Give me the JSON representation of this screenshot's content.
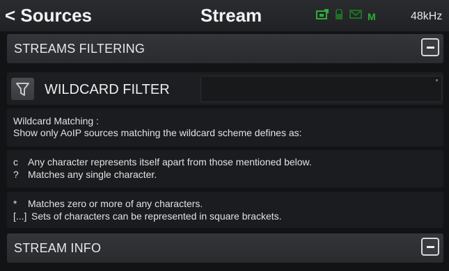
{
  "header": {
    "back_label": "< Sources",
    "title": "Stream",
    "sample_rate": "48kHz",
    "status_icons": [
      "network-icon",
      "lock-icon",
      "monitor-icon"
    ],
    "monitor_letter": "M"
  },
  "sections": {
    "streams_filtering": "STREAMS FILTERING",
    "stream_info": "STREAM INFO"
  },
  "filter": {
    "label": "WILDCARD FILTER",
    "value": ""
  },
  "info_blocks": {
    "matching": {
      "line1": "Wildcard Matching :",
      "line2": "Show only AoIP sources matching the wildcard scheme defines as:"
    },
    "rules1": [
      {
        "symbol": "c",
        "text": "Any character represents itself apart from those mentioned below."
      },
      {
        "symbol": "?",
        "text": "Matches any single character."
      }
    ],
    "rules2": [
      {
        "symbol": "*",
        "text": "Matches zero or more of any characters."
      },
      {
        "symbol": "[...]",
        "text": "Sets of characters can be represented in square brackets."
      }
    ]
  },
  "colors": {
    "background": "#121315",
    "bar": "#2f3034",
    "status_green": "#2fae3a",
    "text": "#e6e6e6"
  }
}
